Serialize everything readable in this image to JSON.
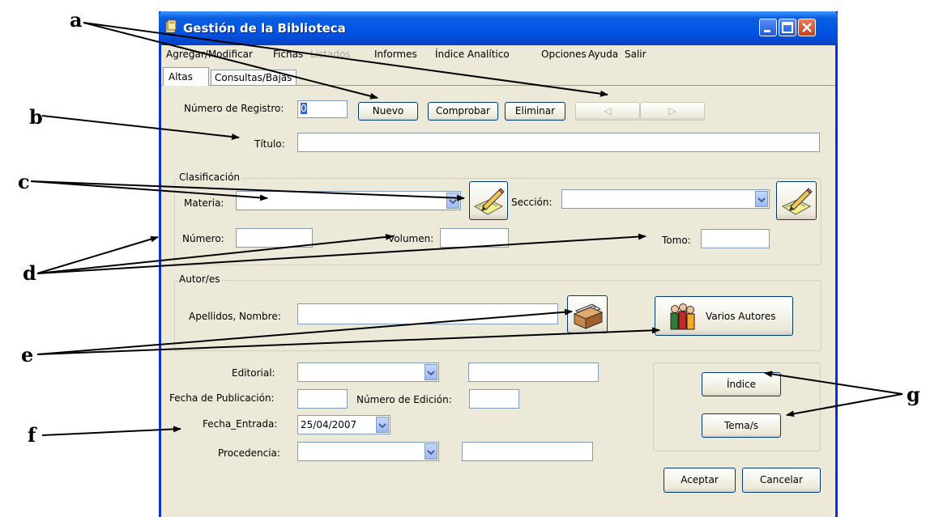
{
  "window": {
    "title": "Gestión de la Biblioteca",
    "controls": {
      "minimize_icon": "minimize-icon",
      "maximize_icon": "maximize-icon",
      "close_icon": "close-icon"
    }
  },
  "menu": [
    "Agregar/Modificar",
    "Fichas",
    "Listados",
    "Informes",
    "Índice Analítico",
    "Opciones",
    "Ayuda",
    "Salir"
  ],
  "menu_disabled": [
    "Listados"
  ],
  "tabs": [
    "Altas",
    "Consultas/Bajas"
  ],
  "active_tab": "Altas",
  "registro": {
    "label": "Número de Registro:",
    "value": "0",
    "buttons": {
      "nuevo": "Nuevo",
      "comprobar": "Comprobar",
      "eliminar": "Eliminar",
      "prev": "◁",
      "next": "▷"
    }
  },
  "titulo": {
    "label": "Título:",
    "value": ""
  },
  "clasificacion": {
    "title": "Clasificación",
    "materia_label": "Materia:",
    "materia_value": "",
    "seccion_label": "Sección:",
    "seccion_value": "",
    "numero_label": "Número:",
    "volumen_label": "Volumen:",
    "tomo_label": "Tomo:"
  },
  "autores": {
    "title": "Autor/es",
    "nombre_label": "Apellidos, Nombre:",
    "nombre_value": "",
    "varios_label": "Varios Autores"
  },
  "publicacion": {
    "editorial_label": "Editorial:",
    "fecha_pub_label": "Fecha de Publicación:",
    "edicion_label": "Número de Edición:",
    "fecha_entrada_label": "Fecha_Entrada:",
    "fecha_entrada_value": "25/04/2007",
    "procedencia_label": "Procedencia:"
  },
  "side_buttons": {
    "indice": "Índice",
    "temas": "Tema/s"
  },
  "actions": {
    "aceptar": "Aceptar",
    "cancelar": "Cancelar"
  },
  "callouts": [
    "a",
    "b",
    "c",
    "d",
    "e",
    "f",
    "g"
  ],
  "colors": {
    "titlebar": "#0055e5",
    "window_bg": "#ece9d8",
    "arrow": "#000000",
    "close": "#c4401e"
  }
}
